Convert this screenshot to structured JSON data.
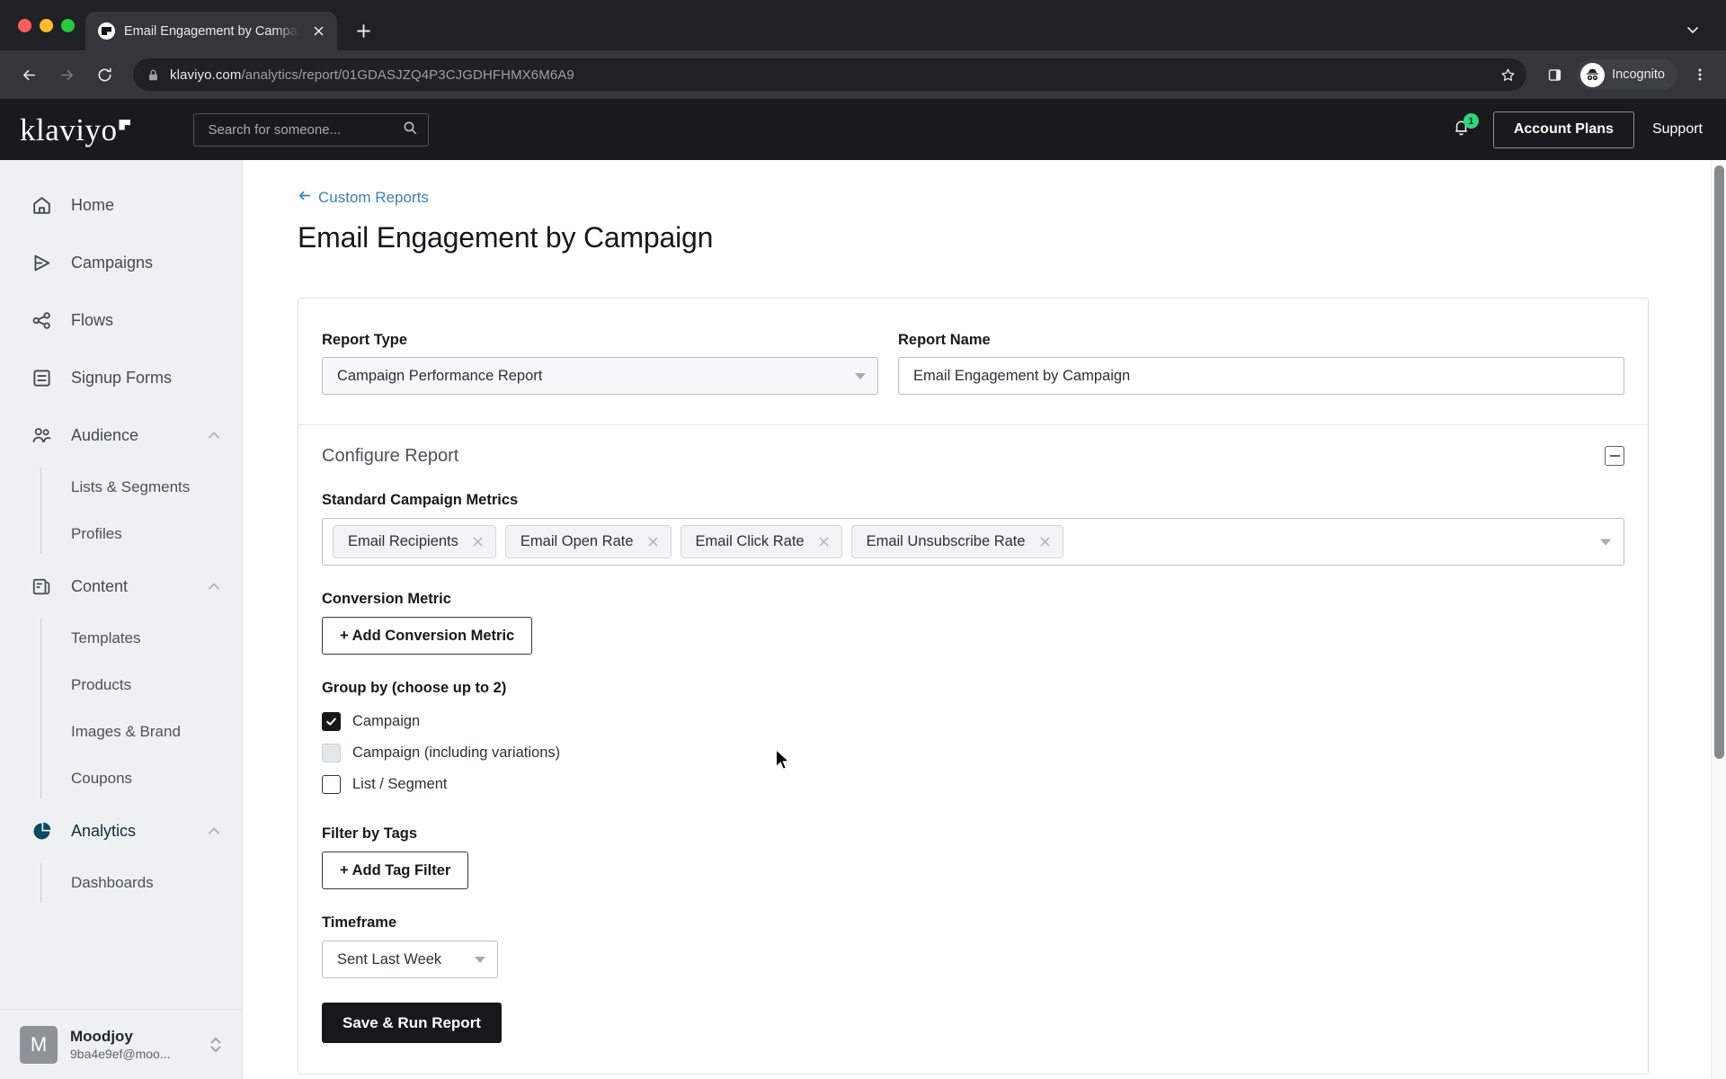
{
  "browser": {
    "tab": {
      "title": "Email Engagement by Campaig",
      "favicon": "klaviyo-favicon-icon",
      "close_icon": "close-icon"
    },
    "new_tab_icon": "plus-icon",
    "window_chevron_icon": "chevron-down-icon",
    "back_icon": "back-arrow-icon",
    "forward_icon": "forward-arrow-icon",
    "reload_icon": "reload-icon",
    "lock_icon": "lock-icon",
    "url_host": "klaviyo.com",
    "url_path": "/analytics/report/01GDASJZQ4P3CJGDHFHMX6M6A9",
    "star_icon": "bookmark-star-icon",
    "side_panel_icon": "side-panel-icon",
    "incognito_label": "Incognito",
    "incognito_icon": "incognito-icon",
    "menu_icon": "kebab-menu-icon"
  },
  "app_header": {
    "logo_text": "klaviyo",
    "search": {
      "placeholder": "Search for someone...",
      "value": "",
      "icon": "search-icon"
    },
    "notifications": {
      "icon": "bell-icon",
      "count": "1",
      "badge_color": "#31d67e"
    },
    "account_plans_label": "Account Plans",
    "support_label": "Support"
  },
  "sidebar": {
    "items": [
      {
        "label": "Home",
        "icon": "home-icon",
        "active": false
      },
      {
        "label": "Campaigns",
        "icon": "campaigns-send-icon",
        "active": false
      },
      {
        "label": "Flows",
        "icon": "flows-nodes-icon",
        "active": false
      },
      {
        "label": "Signup Forms",
        "icon": "signup-forms-icon",
        "active": false
      },
      {
        "label": "Audience",
        "icon": "audience-people-icon",
        "active": false,
        "expanded": true
      },
      {
        "label": "Content",
        "icon": "content-pages-icon",
        "active": false,
        "expanded": true
      },
      {
        "label": "Analytics",
        "icon": "analytics-pie-icon",
        "active": true,
        "expanded": true
      }
    ],
    "audience_children": [
      {
        "label": "Lists & Segments"
      },
      {
        "label": "Profiles"
      }
    ],
    "content_children": [
      {
        "label": "Templates"
      },
      {
        "label": "Products"
      },
      {
        "label": "Images & Brand"
      },
      {
        "label": "Coupons"
      }
    ],
    "analytics_children": [
      {
        "label": "Dashboards"
      }
    ],
    "account": {
      "avatar_initial": "M",
      "name": "Moodjoy",
      "email": "9ba4e9ef@moo...",
      "switch_icon": "up-down-chevron-icon"
    }
  },
  "main": {
    "breadcrumb": {
      "label": "Custom Reports",
      "icon": "back-arrow-icon"
    },
    "page_title": "Email Engagement by Campaign",
    "report_type": {
      "label": "Report Type",
      "value": "Campaign Performance Report",
      "caret_icon": "caret-down-icon"
    },
    "report_name": {
      "label": "Report Name",
      "value": "Email Engagement by Campaign",
      "placeholder": "Report Name"
    },
    "configure": {
      "title": "Configure Report",
      "collapse_icon": "collapse-minus-icon",
      "metrics": {
        "label": "Standard Campaign Metrics",
        "chips": [
          {
            "label": "Email Recipients",
            "remove_icon": "close-icon"
          },
          {
            "label": "Email Open Rate",
            "remove_icon": "close-icon"
          },
          {
            "label": "Email Click Rate",
            "remove_icon": "close-icon"
          },
          {
            "label": "Email Unsubscribe Rate",
            "remove_icon": "close-icon"
          }
        ],
        "caret_icon": "caret-down-icon"
      },
      "conversion_metric": {
        "label": "Conversion Metric",
        "button_label": "+ Add Conversion Metric"
      },
      "group_by": {
        "label": "Group by (choose up to 2)",
        "options": [
          {
            "label": "Campaign",
            "state": "checked"
          },
          {
            "label": "Campaign (including variations)",
            "state": "disabled"
          },
          {
            "label": "List / Segment",
            "state": "unchecked"
          }
        ]
      },
      "filter_by_tags": {
        "label": "Filter by Tags",
        "button_label": "+ Add Tag Filter"
      },
      "timeframe": {
        "label": "Timeframe",
        "value": "Sent Last Week",
        "caret_icon": "caret-down-icon"
      },
      "submit_label": "Save & Run Report"
    }
  }
}
